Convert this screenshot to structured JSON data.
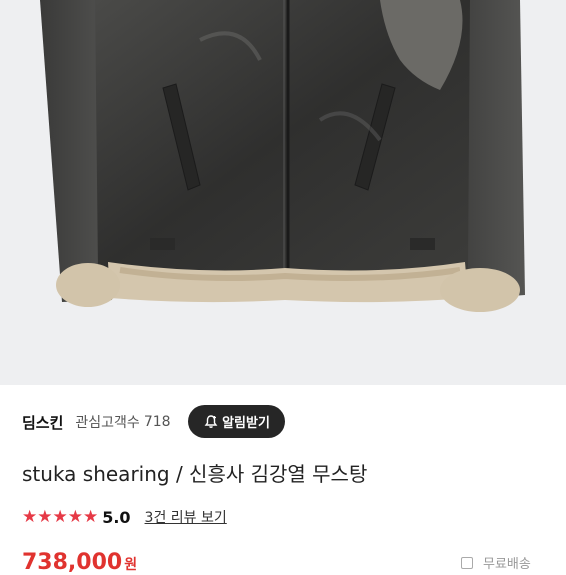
{
  "product": {
    "image_alt": "black shearling flight jacket",
    "title": "stuka shearing / 신흥사 김강열 무스탕",
    "rating": "5.0",
    "stars": "★★★★★",
    "review_link": "3건 리뷰 보기",
    "price": "738,000",
    "price_unit": "원",
    "shipping": "무료배송"
  },
  "store": {
    "name": "딤스킨",
    "fav_label": "관심고객수",
    "fav_count": "718",
    "alert_label": "알림받기"
  },
  "colors": {
    "accent": "#e63946",
    "price": "#e0332f",
    "button": "#262626",
    "photo_bg": "#eeeff1"
  },
  "icons": [
    "bell-plus-icon",
    "star-icon",
    "truck-icon"
  ]
}
